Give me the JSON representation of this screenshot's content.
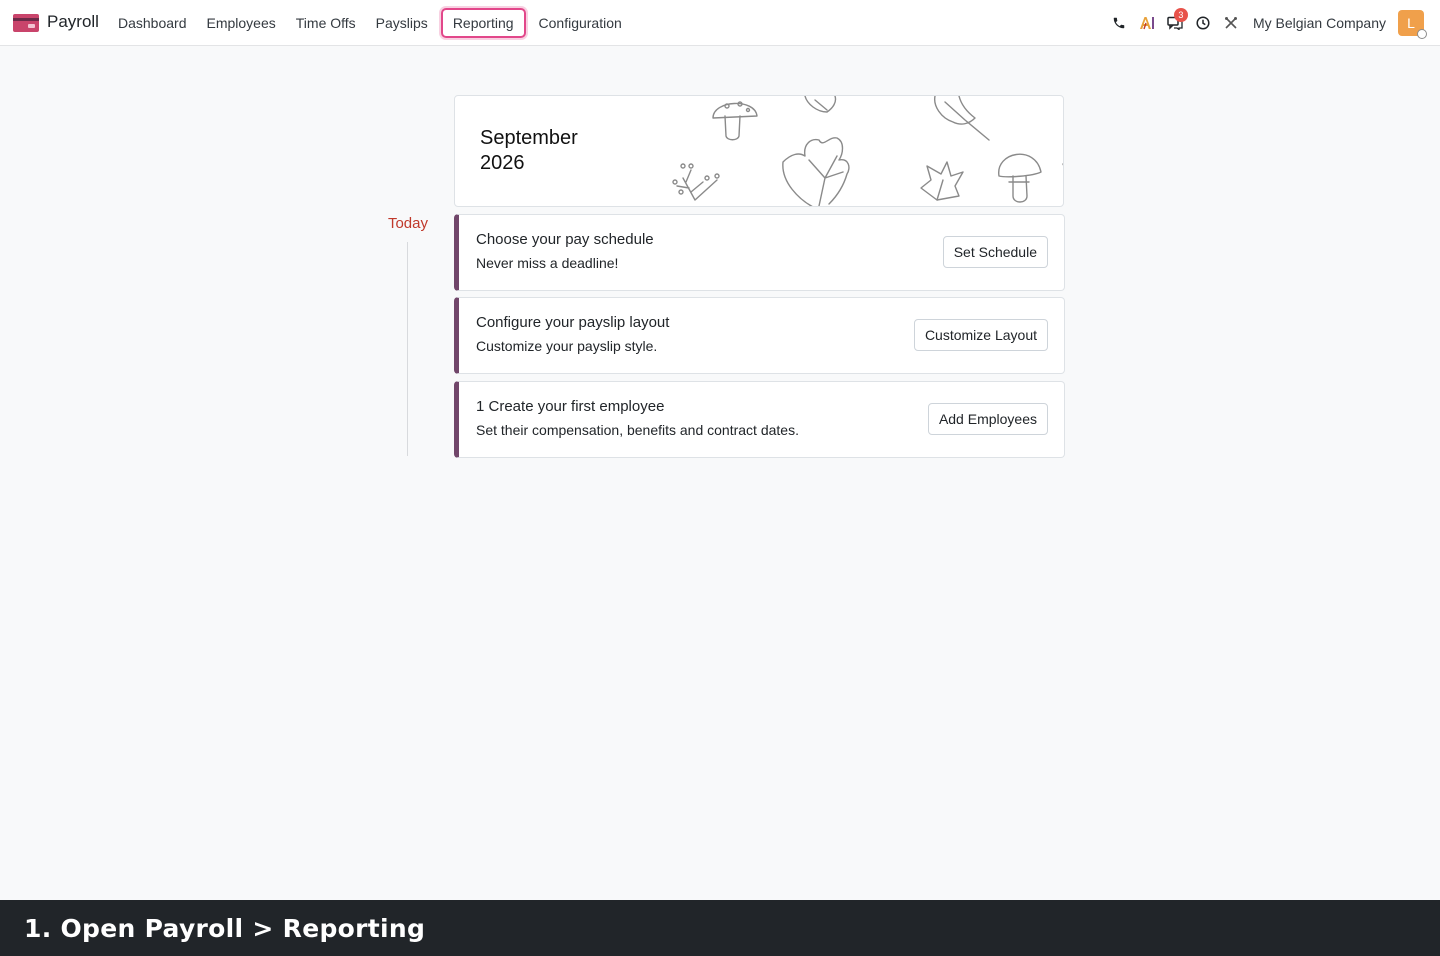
{
  "navbar": {
    "app_name": "Payroll",
    "menu": [
      {
        "label": "Dashboard"
      },
      {
        "label": "Employees"
      },
      {
        "label": "Time Offs"
      },
      {
        "label": "Payslips"
      },
      {
        "label": "Reporting",
        "highlighted": true
      },
      {
        "label": "Configuration"
      }
    ],
    "systray": {
      "phone_icon": "phone-icon",
      "ai_icon": "ai-icon",
      "messages_icon": "messages-icon",
      "messages_badge": "3",
      "activity_icon": "clock-icon",
      "tools_icon": "tools-icon",
      "company": "My Belgian Company",
      "avatar_letter": "L"
    }
  },
  "calendar": {
    "month": "September",
    "year": "2026"
  },
  "timeline": {
    "today_label": "Today"
  },
  "tasks": [
    {
      "title": "Choose your pay schedule",
      "subtitle": "Never miss a deadline!",
      "button": "Set Schedule"
    },
    {
      "title": "Configure your payslip layout",
      "subtitle": "Customize your payslip style.",
      "button": "Customize Layout"
    },
    {
      "title": "1 Create your first employee",
      "subtitle": "Set their compensation, benefits and contract dates.",
      "button": "Add Employees"
    }
  ],
  "caption": "1. Open Payroll > Reporting",
  "colors": {
    "accent": "#71466a",
    "highlight": "#e2478a",
    "today": "#c0392b",
    "caption_bg": "#212529"
  }
}
